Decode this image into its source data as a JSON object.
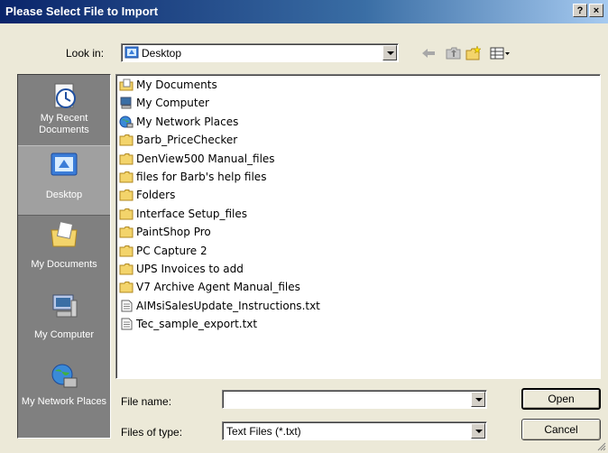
{
  "window": {
    "title": "Please Select File to Import",
    "help_label": "?",
    "close_label": "×"
  },
  "lookin": {
    "label": "Look in:",
    "value": "Desktop"
  },
  "toolbar": {
    "icons": [
      "back-arrow-icon",
      "up-folder-icon",
      "new-folder-icon",
      "view-menu-icon"
    ]
  },
  "places": [
    {
      "label": "My Recent Documents",
      "icon": "recent-documents-icon"
    },
    {
      "label": "Desktop",
      "icon": "desktop-icon"
    },
    {
      "label": "My Documents",
      "icon": "my-documents-icon"
    },
    {
      "label": "My Computer",
      "icon": "my-computer-icon"
    },
    {
      "label": "My Network Places",
      "icon": "network-places-icon"
    }
  ],
  "files": [
    {
      "name": "My Documents",
      "type": "mydocs"
    },
    {
      "name": "My Computer",
      "type": "computer"
    },
    {
      "name": "My Network Places",
      "type": "network"
    },
    {
      "name": "Barb_PriceChecker",
      "type": "folder"
    },
    {
      "name": "DenView500 Manual_files",
      "type": "folder"
    },
    {
      "name": "files for Barb's help files",
      "type": "folder"
    },
    {
      "name": "Folders",
      "type": "folder"
    },
    {
      "name": "Interface Setup_files",
      "type": "folder"
    },
    {
      "name": "PaintShop Pro",
      "type": "folder"
    },
    {
      "name": "PC Capture 2",
      "type": "folder"
    },
    {
      "name": "UPS Invoices to add",
      "type": "folder"
    },
    {
      "name": "V7 Archive Agent Manual_files",
      "type": "folder"
    },
    {
      "name": "AIMsiSalesUpdate_Instructions.txt",
      "type": "text"
    },
    {
      "name": "Tec_sample_export.txt",
      "type": "text"
    }
  ],
  "filename": {
    "label": "File name:",
    "value": ""
  },
  "filetype": {
    "label": "Files of type:",
    "value": "Text Files (*.txt)"
  },
  "buttons": {
    "open": "Open",
    "cancel": "Cancel"
  },
  "colors": {
    "titlebar_start": "#0a246a",
    "dialog_bg": "#ece9d8",
    "places_bg": "#808080",
    "folder_yellow": "#f3d46b"
  }
}
